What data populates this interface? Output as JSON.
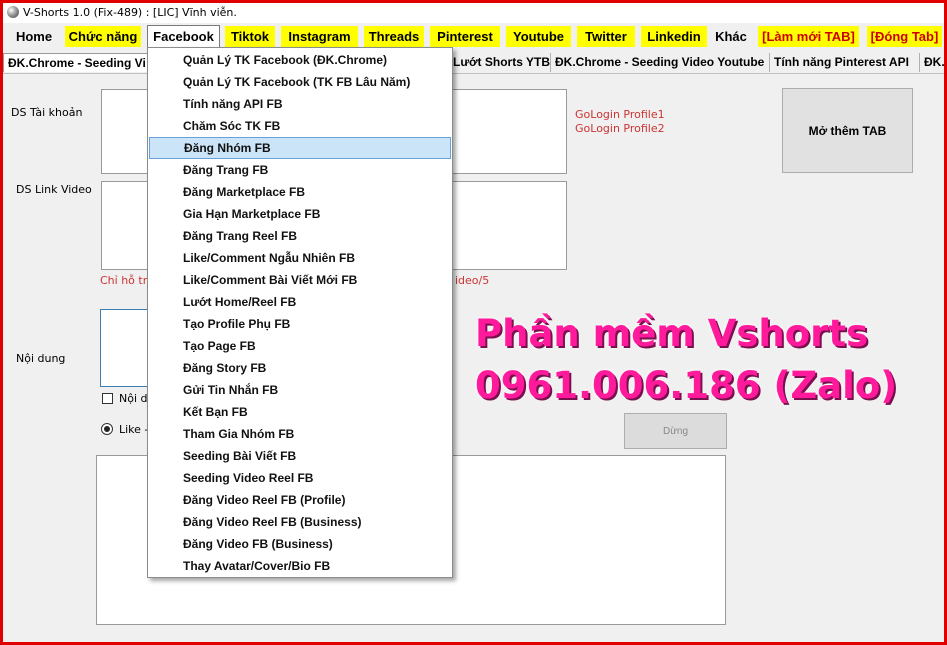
{
  "window": {
    "title": "V-Shorts 1.0 (Fix-489) : [LIC] Vĩnh viễn."
  },
  "menu": [
    {
      "label": "Home"
    },
    {
      "label": "Chức năng"
    },
    {
      "label": "Facebook"
    },
    {
      "label": "Tiktok"
    },
    {
      "label": "Instagram"
    },
    {
      "label": "Threads"
    },
    {
      "label": "Pinterest"
    },
    {
      "label": "Youtube"
    },
    {
      "label": "Twitter"
    },
    {
      "label": "Linkedin"
    },
    {
      "label": "Khác"
    },
    {
      "label": "[Làm mới TAB]"
    },
    {
      "label": "[Đóng Tab]"
    }
  ],
  "tabs": [
    {
      "label": "ĐK.Chrome - Seeding Vi"
    },
    {
      "label": "Lướt Shorts YTB"
    },
    {
      "label": "ĐK.Chrome - Seeding Video Youtube"
    },
    {
      "label": "Tính năng Pinterest API"
    },
    {
      "label": "ĐK."
    }
  ],
  "form": {
    "accounts_label": "DS Tài khoản",
    "video_links_label": "DS Link Video",
    "content_label": "Nội dung",
    "hint_left": "Chỉ hỗ trợ",
    "hint_right": "ideo/5",
    "checkbox_label": "Nội d",
    "radio_label": "Like -"
  },
  "profiles": [
    "GoLogin Profile1",
    "GoLogin Profile2"
  ],
  "buttons": {
    "open_tab": "Mở thêm TAB",
    "stop": "Dừng"
  },
  "facebook_menu": [
    {
      "label": "Quản Lý TK Facebook (ĐK.Chrome)"
    },
    {
      "label": "Quản Lý TK Facebook (TK FB Lâu Năm)"
    },
    {
      "label": "Tính năng API FB"
    },
    {
      "label": "Chăm Sóc TK FB"
    },
    {
      "label": "Đăng Nhóm FB",
      "highlighted": true
    },
    {
      "label": "Đăng Trang FB"
    },
    {
      "label": "Đăng Marketplace FB"
    },
    {
      "label": "Gia Hạn Marketplace FB"
    },
    {
      "label": "Đăng Trang Reel FB"
    },
    {
      "label": "Like/Comment Ngẫu Nhiên FB"
    },
    {
      "label": "Like/Comment Bài Viết Mới FB"
    },
    {
      "label": "Lướt Home/Reel FB"
    },
    {
      "label": "Tạo Profile Phụ FB"
    },
    {
      "label": "Tạo Page FB"
    },
    {
      "label": "Đăng Story FB"
    },
    {
      "label": "Gửi Tin Nhắn FB"
    },
    {
      "label": "Kết Bạn FB"
    },
    {
      "label": "Tham Gia Nhóm FB"
    },
    {
      "label": "Seeding Bài Viết FB"
    },
    {
      "label": "Seeding Video Reel FB"
    },
    {
      "label": "Đăng Video Reel FB (Profile)"
    },
    {
      "label": "Đăng Video Reel FB (Business)"
    },
    {
      "label": "Đăng Video FB (Business)"
    },
    {
      "label": "Thay Avatar/Cover/Bio FB"
    }
  ],
  "promo": {
    "line1": "Phần mềm Vshorts",
    "line2": "0961.006.186 (Zalo)"
  },
  "colors": {
    "frame_border": "#e00000",
    "menu_highlight": "#ffff00",
    "promo_text": "#ff1a9c",
    "selection": "#cce4f7"
  }
}
